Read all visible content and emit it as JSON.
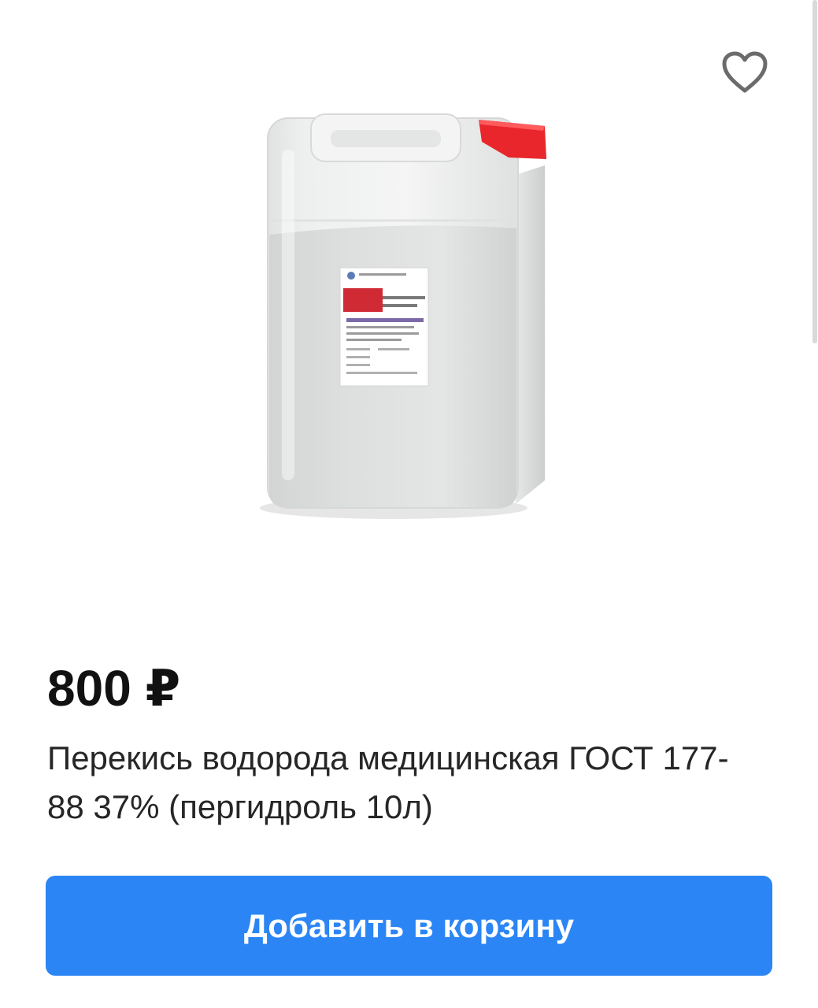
{
  "product": {
    "price": "800 ₽",
    "title": "Перекись водорода медицинская ГОСТ 177-88 37% (пергидроль 10л)",
    "image_icon": "canister-image"
  },
  "actions": {
    "favorite_icon": "heart-outline-icon",
    "add_to_cart_label": "Добавить в корзину"
  },
  "colors": {
    "accent": "#2b85f5",
    "cap": "#e8262b",
    "heart": "#6b6b6b"
  }
}
